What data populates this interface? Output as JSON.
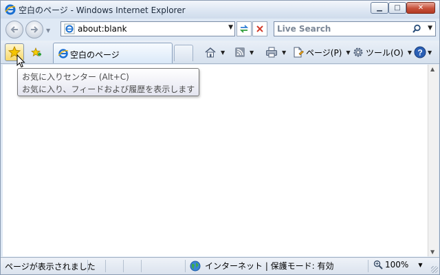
{
  "window": {
    "title": "空白のページ - Windows Internet Explorer",
    "min_glyph": "▁",
    "max_glyph": "□",
    "close_glyph": "✕"
  },
  "address_bar": {
    "url": "about:blank"
  },
  "search": {
    "placeholder": "Live Search"
  },
  "tabs": [
    {
      "label": "空白のページ"
    }
  ],
  "toolbar": {
    "page_label": "ページ(P)",
    "tools_label": "ツール(O)"
  },
  "tooltip": {
    "line1": "お気に入りセンター (Alt+C)",
    "line2": "お気に入り、フィードおよび履歴を表示します"
  },
  "status": {
    "text": "ページが表示されました",
    "zone": "インターネット | 保護モード: 有効",
    "zoom": "100%"
  },
  "colors": {
    "ie_blue": "#1a6fd1",
    "star_yellow": "#f5c400",
    "close_red": "#c7503a"
  }
}
